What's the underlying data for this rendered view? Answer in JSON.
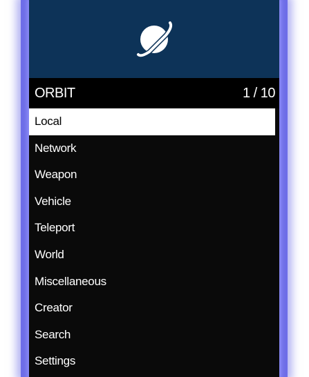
{
  "menu": {
    "logo_icon": "planet-ring-icon",
    "banner_color": "#0d3358",
    "title": "ORBIT",
    "counter": "1 / 10",
    "selected_index": 0,
    "items": [
      {
        "label": "Local"
      },
      {
        "label": "Network"
      },
      {
        "label": "Weapon"
      },
      {
        "label": "Vehicle"
      },
      {
        "label": "Teleport"
      },
      {
        "label": "World"
      },
      {
        "label": "Miscellaneous"
      },
      {
        "label": "Creator"
      },
      {
        "label": "Search"
      },
      {
        "label": "Settings"
      }
    ]
  }
}
